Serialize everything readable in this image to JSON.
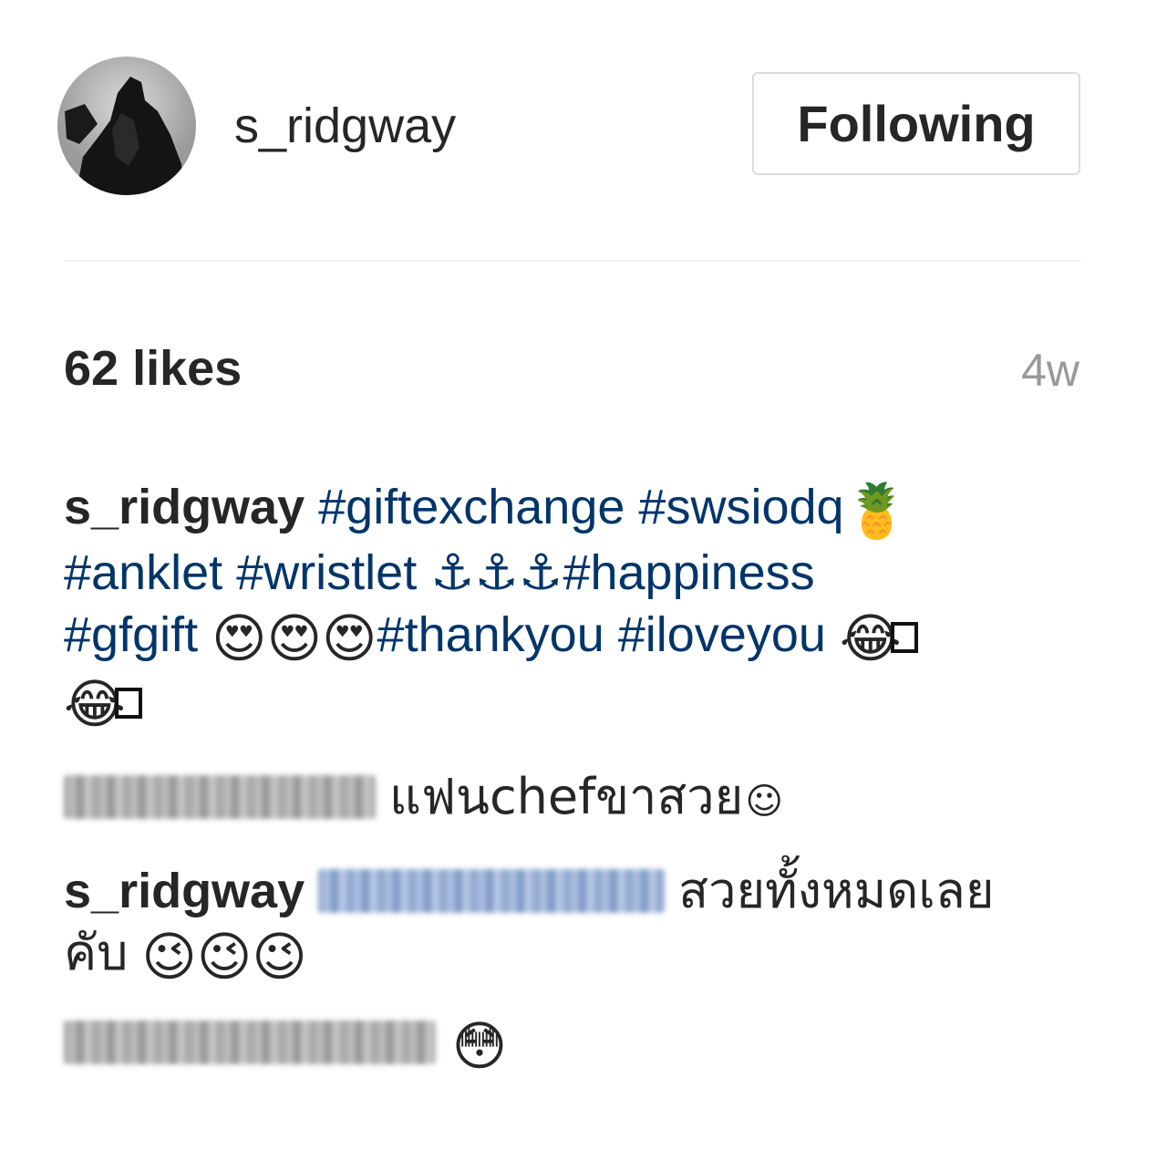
{
  "header": {
    "username": "s_ridgway",
    "follow_button": "Following"
  },
  "stats": {
    "likes": "62 likes",
    "time": "4w"
  },
  "caption": {
    "username": "s_ridgway",
    "tag_giftexchange": "#giftexchange",
    "tag_swsiodq": "#swsiodq",
    "emoji_pineapple": "🍍",
    "tag_anklet": "#anklet",
    "tag_wristlet": "#wristlet",
    "emoji_anchors": "⚓⚓⚓",
    "tag_happiness": "#happiness",
    "tag_gfgift": "#gfgift",
    "emoji_hearteyes": "😍😍😍",
    "tag_thankyou": "#thankyou",
    "tag_iloveyou": "#iloveyou",
    "emoji_laugh": "😂"
  },
  "comments": [
    {
      "text": "แฟนchefขาสวย",
      "emoji": "☺"
    },
    {
      "username": "s_ridgway",
      "text_line1": "สวยทั้งหมดเลย",
      "text_line2": "คับ",
      "emoji": "😉😉😉"
    },
    {
      "emoji": "😳"
    }
  ],
  "icons": {
    "avatar": "profile-avatar",
    "missing_glyph": "missing-glyph-box"
  }
}
